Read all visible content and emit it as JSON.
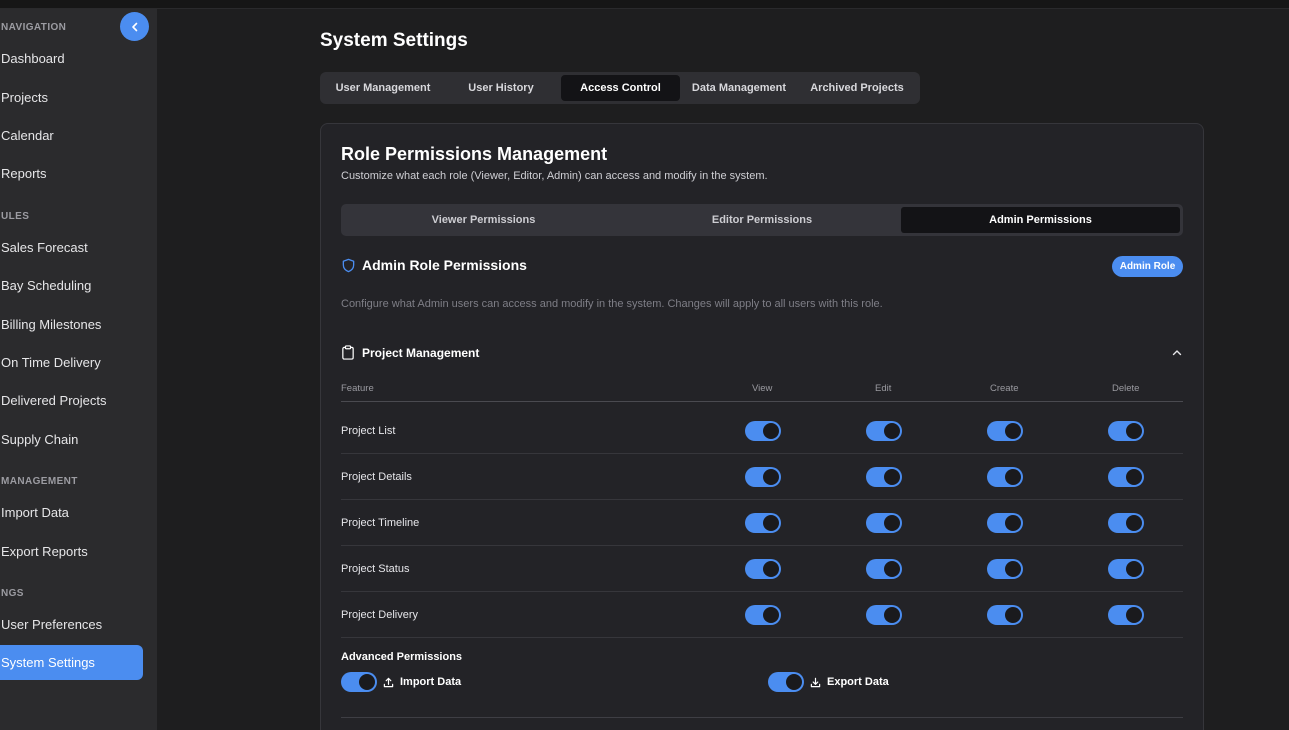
{
  "sidebar": {
    "sections": [
      "NAVIGATION",
      "ULES",
      "MANAGEMENT",
      "NGS"
    ],
    "items": [
      {
        "label": "Dashboard"
      },
      {
        "label": "Projects"
      },
      {
        "label": "Calendar"
      },
      {
        "label": "Reports"
      },
      {
        "label": "Sales Forecast"
      },
      {
        "label": "Bay Scheduling"
      },
      {
        "label": "Billing Milestones"
      },
      {
        "label": "On Time Delivery"
      },
      {
        "label": "Delivered Projects"
      },
      {
        "label": "Supply Chain"
      },
      {
        "label": "Import Data"
      },
      {
        "label": "Export Reports"
      },
      {
        "label": "User Preferences"
      },
      {
        "label": "System Settings",
        "active": true
      }
    ]
  },
  "page": {
    "title": "System Settings",
    "tabs": [
      {
        "label": "User Management"
      },
      {
        "label": "User History"
      },
      {
        "label": "Access Control",
        "active": true
      },
      {
        "label": "Data Management"
      },
      {
        "label": "Archived Projects"
      }
    ]
  },
  "card": {
    "title": "Role Permissions Management",
    "subtitle": "Customize what each role (Viewer, Editor, Admin) can access and modify in the system.",
    "subtabs": [
      {
        "label": "Viewer Permissions"
      },
      {
        "label": "Editor Permissions"
      },
      {
        "label": "Admin Permissions",
        "active": true
      }
    ],
    "role": {
      "title": "Admin Role Permissions",
      "badge": "Admin Role",
      "description": "Configure what Admin users can access and modify in the system. Changes will apply to all users with this role."
    },
    "group": {
      "title": "Project Management",
      "columns": [
        "Feature",
        "View",
        "Edit",
        "Create",
        "Delete"
      ],
      "rows": [
        {
          "label": "Project List",
          "view": true,
          "edit": true,
          "create": true,
          "delete": true
        },
        {
          "label": "Project Details",
          "view": true,
          "edit": true,
          "create": true,
          "delete": true
        },
        {
          "label": "Project Timeline",
          "view": true,
          "edit": true,
          "create": true,
          "delete": true
        },
        {
          "label": "Project Status",
          "view": true,
          "edit": true,
          "create": true,
          "delete": true
        },
        {
          "label": "Project Delivery",
          "view": true,
          "edit": true,
          "create": true,
          "delete": true
        }
      ]
    },
    "advanced": {
      "title": "Advanced Permissions",
      "items": [
        {
          "label": "Import Data",
          "icon": "upload-icon",
          "enabled": true
        },
        {
          "label": "Export Data",
          "icon": "download-icon",
          "enabled": true
        }
      ]
    }
  },
  "colors": {
    "accent": "#4b8df0",
    "background": "#1e1e1f",
    "sidebar": "#2b2b2d",
    "card": "#232327"
  }
}
